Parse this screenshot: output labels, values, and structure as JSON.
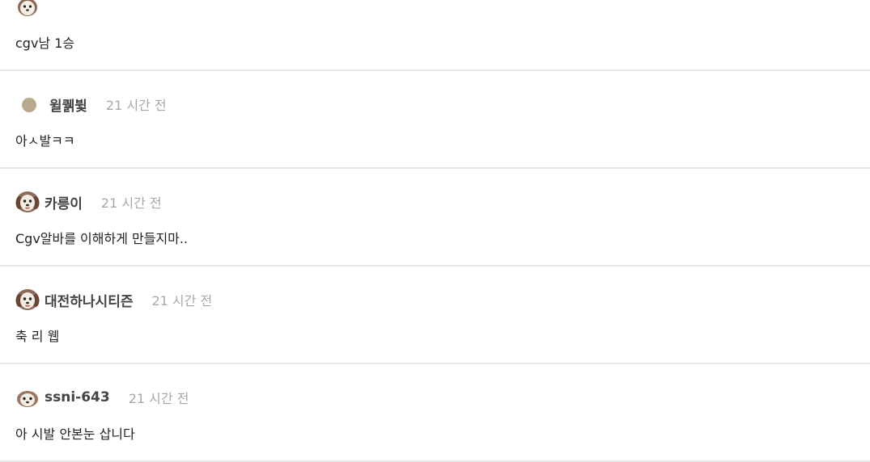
{
  "comments": [
    {
      "author": "",
      "time": "",
      "avatar": "puppy-icon",
      "text": "cgv남 1승"
    },
    {
      "author": "윌퀡뷫",
      "time": "21 시간 전",
      "avatar": "default-avatar-dot",
      "text": "아ㅅ발ㅋㅋ"
    },
    {
      "author": "카릉이",
      "time": "21 시간 전",
      "avatar": "puppy-icon",
      "text": "Cgv알바를 이해하게 만들지마.."
    },
    {
      "author": "대전하나시티즌",
      "time": "21 시간 전",
      "avatar": "puppy-icon",
      "text": "축 리 웹"
    },
    {
      "author": "ssni-643",
      "time": "21 시간 전",
      "avatar": "puppy-icon",
      "text": "아 시발 안본눈 삽니다"
    }
  ],
  "colors": {
    "divider": "#e7e7e7",
    "author": "#444444",
    "time": "#a8a8a8",
    "text": "#222222",
    "avatar_dot": "#b8a98c"
  }
}
